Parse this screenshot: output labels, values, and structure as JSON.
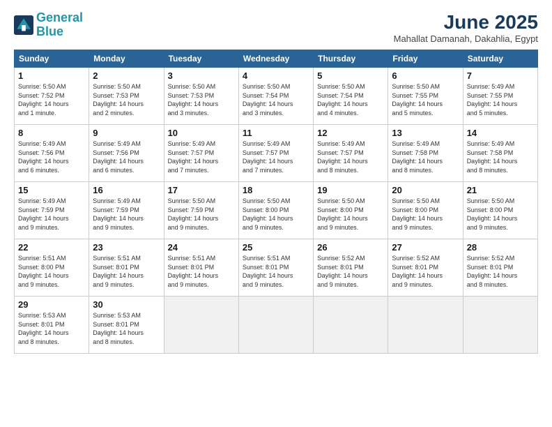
{
  "header": {
    "logo_line1": "General",
    "logo_line2": "Blue",
    "title": "June 2025",
    "subtitle": "Mahallat Damanah, Dakahlia, Egypt"
  },
  "days_of_week": [
    "Sunday",
    "Monday",
    "Tuesday",
    "Wednesday",
    "Thursday",
    "Friday",
    "Saturday"
  ],
  "weeks": [
    [
      {
        "day": "1",
        "info": "Sunrise: 5:50 AM\nSunset: 7:52 PM\nDaylight: 14 hours\nand 1 minute."
      },
      {
        "day": "2",
        "info": "Sunrise: 5:50 AM\nSunset: 7:53 PM\nDaylight: 14 hours\nand 2 minutes."
      },
      {
        "day": "3",
        "info": "Sunrise: 5:50 AM\nSunset: 7:53 PM\nDaylight: 14 hours\nand 3 minutes."
      },
      {
        "day": "4",
        "info": "Sunrise: 5:50 AM\nSunset: 7:54 PM\nDaylight: 14 hours\nand 3 minutes."
      },
      {
        "day": "5",
        "info": "Sunrise: 5:50 AM\nSunset: 7:54 PM\nDaylight: 14 hours\nand 4 minutes."
      },
      {
        "day": "6",
        "info": "Sunrise: 5:50 AM\nSunset: 7:55 PM\nDaylight: 14 hours\nand 5 minutes."
      },
      {
        "day": "7",
        "info": "Sunrise: 5:49 AM\nSunset: 7:55 PM\nDaylight: 14 hours\nand 5 minutes."
      }
    ],
    [
      {
        "day": "8",
        "info": "Sunrise: 5:49 AM\nSunset: 7:56 PM\nDaylight: 14 hours\nand 6 minutes."
      },
      {
        "day": "9",
        "info": "Sunrise: 5:49 AM\nSunset: 7:56 PM\nDaylight: 14 hours\nand 6 minutes."
      },
      {
        "day": "10",
        "info": "Sunrise: 5:49 AM\nSunset: 7:57 PM\nDaylight: 14 hours\nand 7 minutes."
      },
      {
        "day": "11",
        "info": "Sunrise: 5:49 AM\nSunset: 7:57 PM\nDaylight: 14 hours\nand 7 minutes."
      },
      {
        "day": "12",
        "info": "Sunrise: 5:49 AM\nSunset: 7:57 PM\nDaylight: 14 hours\nand 8 minutes."
      },
      {
        "day": "13",
        "info": "Sunrise: 5:49 AM\nSunset: 7:58 PM\nDaylight: 14 hours\nand 8 minutes."
      },
      {
        "day": "14",
        "info": "Sunrise: 5:49 AM\nSunset: 7:58 PM\nDaylight: 14 hours\nand 8 minutes."
      }
    ],
    [
      {
        "day": "15",
        "info": "Sunrise: 5:49 AM\nSunset: 7:59 PM\nDaylight: 14 hours\nand 9 minutes."
      },
      {
        "day": "16",
        "info": "Sunrise: 5:49 AM\nSunset: 7:59 PM\nDaylight: 14 hours\nand 9 minutes."
      },
      {
        "day": "17",
        "info": "Sunrise: 5:50 AM\nSunset: 7:59 PM\nDaylight: 14 hours\nand 9 minutes."
      },
      {
        "day": "18",
        "info": "Sunrise: 5:50 AM\nSunset: 8:00 PM\nDaylight: 14 hours\nand 9 minutes."
      },
      {
        "day": "19",
        "info": "Sunrise: 5:50 AM\nSunset: 8:00 PM\nDaylight: 14 hours\nand 9 minutes."
      },
      {
        "day": "20",
        "info": "Sunrise: 5:50 AM\nSunset: 8:00 PM\nDaylight: 14 hours\nand 9 minutes."
      },
      {
        "day": "21",
        "info": "Sunrise: 5:50 AM\nSunset: 8:00 PM\nDaylight: 14 hours\nand 9 minutes."
      }
    ],
    [
      {
        "day": "22",
        "info": "Sunrise: 5:51 AM\nSunset: 8:00 PM\nDaylight: 14 hours\nand 9 minutes."
      },
      {
        "day": "23",
        "info": "Sunrise: 5:51 AM\nSunset: 8:01 PM\nDaylight: 14 hours\nand 9 minutes."
      },
      {
        "day": "24",
        "info": "Sunrise: 5:51 AM\nSunset: 8:01 PM\nDaylight: 14 hours\nand 9 minutes."
      },
      {
        "day": "25",
        "info": "Sunrise: 5:51 AM\nSunset: 8:01 PM\nDaylight: 14 hours\nand 9 minutes."
      },
      {
        "day": "26",
        "info": "Sunrise: 5:52 AM\nSunset: 8:01 PM\nDaylight: 14 hours\nand 9 minutes."
      },
      {
        "day": "27",
        "info": "Sunrise: 5:52 AM\nSunset: 8:01 PM\nDaylight: 14 hours\nand 9 minutes."
      },
      {
        "day": "28",
        "info": "Sunrise: 5:52 AM\nSunset: 8:01 PM\nDaylight: 14 hours\nand 8 minutes."
      }
    ],
    [
      {
        "day": "29",
        "info": "Sunrise: 5:53 AM\nSunset: 8:01 PM\nDaylight: 14 hours\nand 8 minutes."
      },
      {
        "day": "30",
        "info": "Sunrise: 5:53 AM\nSunset: 8:01 PM\nDaylight: 14 hours\nand 8 minutes."
      },
      {
        "day": "",
        "info": ""
      },
      {
        "day": "",
        "info": ""
      },
      {
        "day": "",
        "info": ""
      },
      {
        "day": "",
        "info": ""
      },
      {
        "day": "",
        "info": ""
      }
    ]
  ]
}
